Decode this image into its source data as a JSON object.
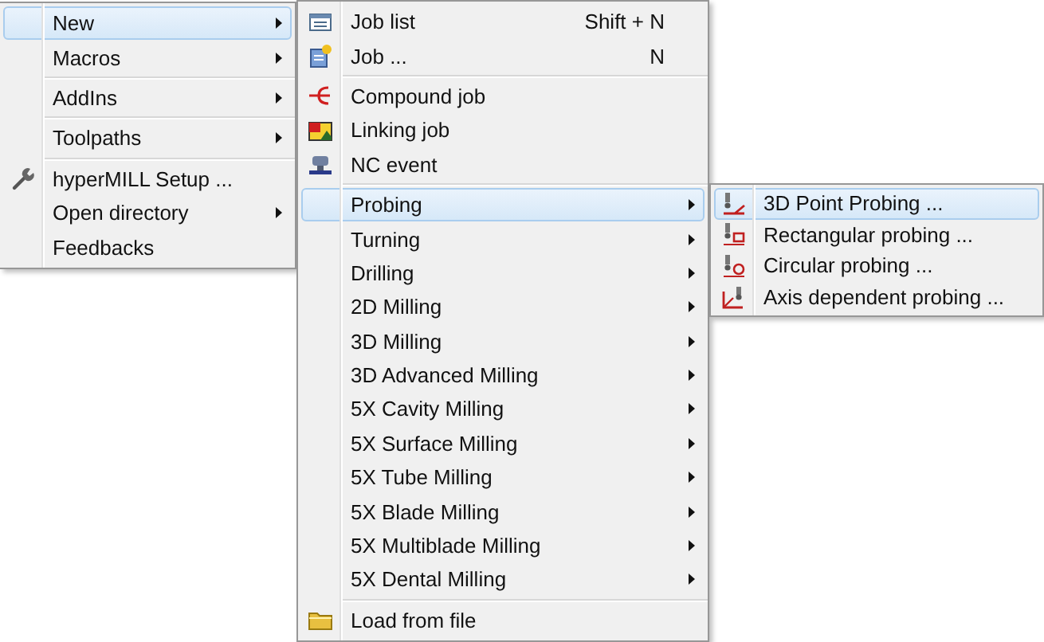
{
  "menus": [
    {
      "items": [
        {
          "kind": "item",
          "label": "New",
          "submenu": true,
          "selected": true
        },
        {
          "kind": "item",
          "label": "Macros",
          "submenu": true,
          "selected": false
        },
        {
          "kind": "separator"
        },
        {
          "kind": "item",
          "label": "AddIns",
          "submenu": true,
          "selected": false
        },
        {
          "kind": "separator"
        },
        {
          "kind": "item",
          "label": "Toolpaths",
          "submenu": true,
          "selected": false
        },
        {
          "kind": "separator"
        },
        {
          "kind": "item",
          "label": "hyperMILL Setup ...",
          "submenu": false,
          "selected": false
        },
        {
          "kind": "item",
          "label": "Open directory",
          "submenu": true,
          "selected": false
        },
        {
          "kind": "item",
          "label": "Feedbacks",
          "submenu": false,
          "selected": false
        }
      ]
    },
    {
      "items": [
        {
          "kind": "item",
          "label": "Job list",
          "shortcut": "Shift + N",
          "submenu": false,
          "selected": false
        },
        {
          "kind": "item",
          "label": "Job ...",
          "shortcut": "N",
          "submenu": false,
          "selected": false
        },
        {
          "kind": "separator"
        },
        {
          "kind": "item",
          "label": "Compound job",
          "submenu": false,
          "selected": false
        },
        {
          "kind": "item",
          "label": "Linking job",
          "submenu": false,
          "selected": false
        },
        {
          "kind": "item",
          "label": "NC event",
          "submenu": false,
          "selected": false
        },
        {
          "kind": "separator"
        },
        {
          "kind": "item",
          "label": "Probing",
          "submenu": true,
          "selected": true
        },
        {
          "kind": "item",
          "label": "Turning",
          "submenu": true,
          "selected": false
        },
        {
          "kind": "item",
          "label": "Drilling",
          "submenu": true,
          "selected": false
        },
        {
          "kind": "item",
          "label": "2D Milling",
          "submenu": true,
          "selected": false
        },
        {
          "kind": "item",
          "label": "3D Milling",
          "submenu": true,
          "selected": false
        },
        {
          "kind": "item",
          "label": "3D Advanced Milling",
          "submenu": true,
          "selected": false
        },
        {
          "kind": "item",
          "label": "5X Cavity Milling",
          "submenu": true,
          "selected": false
        },
        {
          "kind": "item",
          "label": "5X Surface Milling",
          "submenu": true,
          "selected": false
        },
        {
          "kind": "item",
          "label": "5X Tube Milling",
          "submenu": true,
          "selected": false
        },
        {
          "kind": "item",
          "label": "5X Blade Milling",
          "submenu": true,
          "selected": false
        },
        {
          "kind": "item",
          "label": "5X Multiblade Milling",
          "submenu": true,
          "selected": false
        },
        {
          "kind": "item",
          "label": "5X Dental Milling",
          "submenu": true,
          "selected": false
        },
        {
          "kind": "separator"
        },
        {
          "kind": "item",
          "label": "Load from file",
          "submenu": false,
          "selected": false
        }
      ]
    },
    {
      "items": [
        {
          "kind": "item",
          "label": "3D Point Probing ...",
          "submenu": false,
          "selected": true
        },
        {
          "kind": "item",
          "label": "Rectangular probing ...",
          "submenu": false,
          "selected": false
        },
        {
          "kind": "item",
          "label": "Circular probing ...",
          "submenu": false,
          "selected": false
        },
        {
          "kind": "item",
          "label": "Axis dependent probing ...",
          "submenu": false,
          "selected": false
        }
      ]
    }
  ]
}
